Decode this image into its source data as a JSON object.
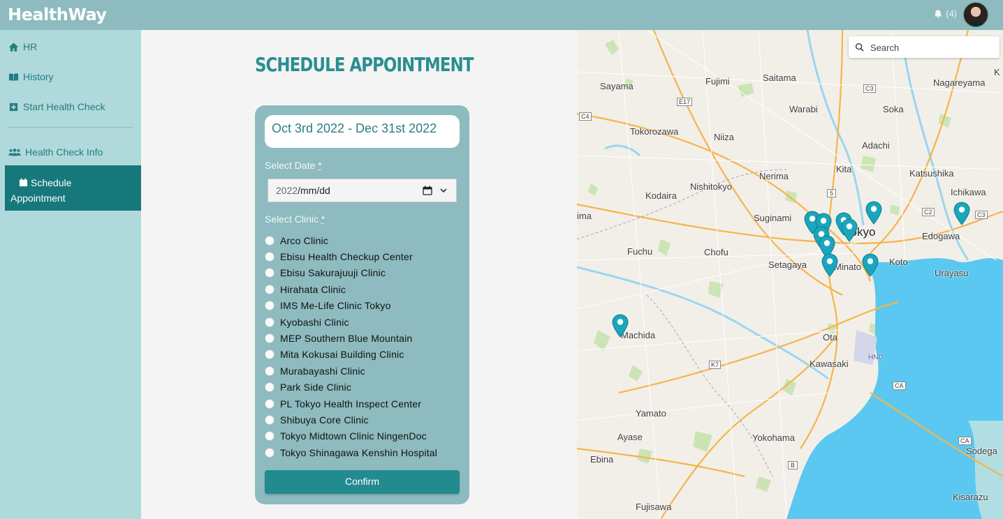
{
  "app": {
    "name": "HealthWay"
  },
  "header": {
    "notification_count": "(4)"
  },
  "sidebar": {
    "items": [
      {
        "label": "HR",
        "icon": "home-icon"
      },
      {
        "label": "History",
        "icon": "book-icon"
      },
      {
        "label": "Start Health Check",
        "icon": "plus-square-icon"
      },
      {
        "label": "Health Check Info",
        "icon": "users-icon"
      }
    ],
    "active_item": {
      "label_line1": "Schedule",
      "label_line2": "Appointment",
      "icon": "calendar-icon"
    }
  },
  "main": {
    "title": "SCHEDULE APPOINTMENT",
    "date_range": "Oct 3rd 2022 - Dec 31st 2022",
    "select_date_label": "Select Date",
    "select_clinic_label": "Select Clinic",
    "required_mark": "*",
    "date_input": {
      "year": "2022",
      "rest": "/mm/dd"
    },
    "clinics": [
      "Arco Clinic",
      "Ebisu Health Checkup Center",
      "Ebisu Sakurajuuji Clinic",
      "Hirahata Clinic",
      "IMS Me-Life Clinic Tokyo",
      "Kyobashi Clinic",
      "MEP Southern Blue Mountain",
      "Mita Kokusai Building Clinic",
      "Murabayashi Clinic",
      "Park Side Clinic",
      "PL Tokyo Health Inspect Center",
      "Shibuya Core Clinic",
      "Tokyo Midtown Clinic NingenDoc",
      "Tokyo Shinagawa Kenshin Hospital"
    ],
    "confirm_label": "Confirm"
  },
  "map": {
    "search_placeholder": "Search",
    "labels": [
      "Sayama",
      "Fujimi",
      "Saitama",
      "Nagareyama",
      "Warabi",
      "Soka",
      "Tokorozawa",
      "Niiza",
      "Adachi",
      "Nerima",
      "Kita",
      "Katsushika",
      "Kodaira",
      "Nishitokyo",
      "Ichikawa",
      "Suginami",
      "Tokyo",
      "Edogawa",
      "Fuchu",
      "Chofu",
      "Setagaya",
      "Minato",
      "Koto",
      "Urayasu",
      "Machida",
      "Ota",
      "HND",
      "Kawasaki",
      "Yamato",
      "Ayase",
      "Yokohama",
      "Ebina",
      "Sodega",
      "Fujisawa",
      "Kisarazu",
      "ima",
      "K"
    ],
    "road_labels": [
      "C3",
      "E17",
      "C4",
      "5",
      "C2",
      "C3",
      "K7",
      "CA",
      "CA",
      "B"
    ],
    "colors": {
      "water": "#5ac8f0",
      "land": "#f2efe9",
      "pin": "#1aa6bd"
    }
  },
  "colors": {
    "header": "#8dbbbf",
    "sidebar": "#b0d9db",
    "active": "#17787c",
    "accent": "#228b8e"
  }
}
